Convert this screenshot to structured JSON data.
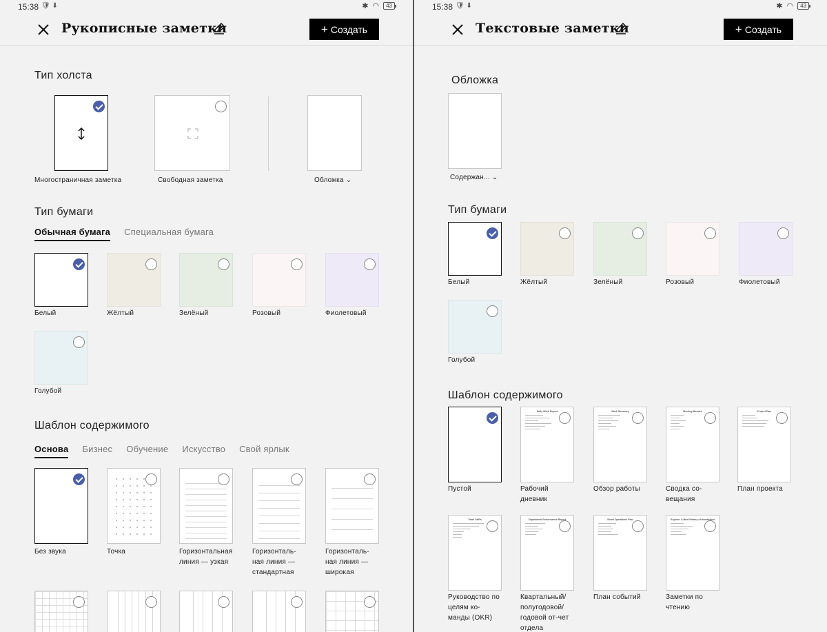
{
  "status": {
    "time": "15:38",
    "battery": "43"
  },
  "left": {
    "title": "Рукописные заметки",
    "create_label": "Создать",
    "canvas_type": {
      "title": "Тип холста",
      "options": [
        {
          "label": "Многостраничная заметка",
          "selected": true
        },
        {
          "label": "Свободная заметка",
          "selected": false
        }
      ],
      "cover_label": "Обложка"
    },
    "paper_type": {
      "title": "Тип бумаги",
      "tabs": [
        "Обычная бумага",
        "Специальная бумага"
      ],
      "colors": [
        {
          "label": "Белый",
          "color": "#ffffff",
          "selected": true
        },
        {
          "label": "Жёлтый",
          "color": "#efece4",
          "selected": false
        },
        {
          "label": "Зелёный",
          "color": "#e6ede3",
          "selected": false
        },
        {
          "label": "Розовый",
          "color": "#fcf5f6",
          "selected": false
        },
        {
          "label": "Фиолетовый",
          "color": "#efeaf8",
          "selected": false
        },
        {
          "label": "Голубой",
          "color": "#e8f1f3",
          "selected": false
        }
      ]
    },
    "content_template": {
      "title": "Шаблон содержимого",
      "tabs": [
        "Основа",
        "Бизнес",
        "Обучение",
        "Искусство",
        "Свой ярлык"
      ],
      "items": [
        {
          "label": "Без звука",
          "selected": true
        },
        {
          "label": "Точка",
          "selected": false
        },
        {
          "label": "Горизонтальная линия — узкая",
          "selected": false
        },
        {
          "label": "Горизонталь-ная линия — стандартная",
          "selected": false
        },
        {
          "label": "Горизонталь-ная линия — широкая",
          "selected": false
        }
      ]
    }
  },
  "right": {
    "title": "Текстовые заметки",
    "create_label": "Создать",
    "cover": {
      "title": "Обложка",
      "label": "Содержан..."
    },
    "paper_type": {
      "title": "Тип бумаги",
      "colors": [
        {
          "label": "Белый",
          "color": "#ffffff",
          "selected": true
        },
        {
          "label": "Жёлтый",
          "color": "#efece4",
          "selected": false
        },
        {
          "label": "Зелёный",
          "color": "#e6ede3",
          "selected": false
        },
        {
          "label": "Розовый",
          "color": "#fcf5f6",
          "selected": false
        },
        {
          "label": "Фиолетовый",
          "color": "#efeaf8",
          "selected": false
        },
        {
          "label": "Голубой",
          "color": "#e8f1f3",
          "selected": false
        }
      ]
    },
    "content_template": {
      "title": "Шаблон содержимого",
      "items": [
        {
          "label": "Пустой",
          "selected": true,
          "doc_title": ""
        },
        {
          "label": "Рабочий дневник",
          "selected": false,
          "doc_title": "Daily Work Report"
        },
        {
          "label": "Обзор работы",
          "selected": false,
          "doc_title": "Work Summary"
        },
        {
          "label": "Сводка со-вещания",
          "selected": false,
          "doc_title": "Meeting Minutes"
        },
        {
          "label": "План проекта",
          "selected": false,
          "doc_title": "Project Plan"
        },
        {
          "label": "Руководство по целям ко-манды (OKR)",
          "selected": false,
          "doc_title": "Team OKRs"
        },
        {
          "label": "Квартальный/ полугодовой/ годовой от-чет отдела",
          "selected": false,
          "doc_title": "Department Performance Report"
        },
        {
          "label": "План событий",
          "selected": false,
          "doc_title": "Event Operations Plan"
        },
        {
          "label": "Заметки по чтению",
          "selected": false,
          "doc_title": "Explore: A Brief History of Humankind"
        }
      ]
    }
  }
}
